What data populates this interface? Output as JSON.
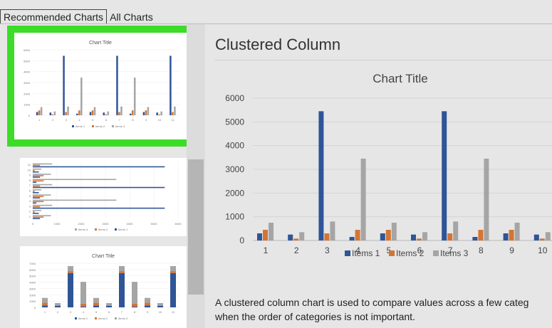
{
  "tabs": [
    "Recommended Charts",
    "All Charts"
  ],
  "preview": {
    "heading": "Clustered Column",
    "description_line1": "A clustered column chart is used to compare values across a few categ",
    "description_line2": "when the order of categories is not important."
  },
  "thumbnails": [
    {
      "name": "clustered-column",
      "title": "Chart Title",
      "selected": true
    },
    {
      "name": "clustered-bar",
      "title": "",
      "selected": false
    },
    {
      "name": "stacked-column",
      "title": "Chart Title",
      "selected": false
    }
  ],
  "colors": {
    "items1": "#2f5597",
    "items2": "#d47535",
    "items3": "#a5a5a5",
    "selection": "#3cdc28"
  },
  "chart_data": {
    "type": "bar",
    "title": "Chart Title",
    "categories": [
      "1",
      "2",
      "3",
      "4",
      "5",
      "6",
      "7",
      "8",
      "9",
      "10",
      "11"
    ],
    "series": [
      {
        "name": "Items 1",
        "values": [
          300,
          250,
          5450,
          150,
          300,
          250,
          5450,
          150,
          300,
          250,
          5450
        ]
      },
      {
        "name": "Items 2",
        "values": [
          450,
          80,
          300,
          450,
          450,
          80,
          300,
          450,
          450,
          80,
          300
        ]
      },
      {
        "name": "Items 3",
        "values": [
          750,
          350,
          800,
          3450,
          750,
          350,
          800,
          3450,
          750,
          350,
          800
        ]
      }
    ],
    "ylim": [
      0,
      6000
    ],
    "yticks": [
      0,
      1000,
      2000,
      3000,
      4000,
      5000,
      6000
    ],
    "legend_position": "bottom",
    "grid": true
  }
}
